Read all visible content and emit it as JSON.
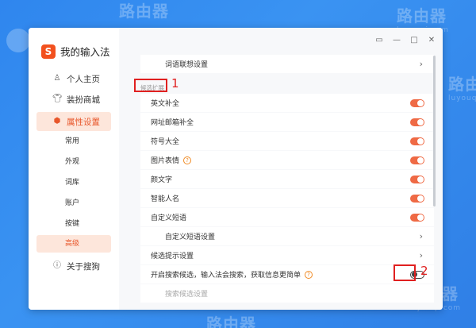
{
  "watermark": {
    "text": "路由器",
    "sub": "luyouqi.com"
  },
  "app": {
    "logo_char": "S",
    "title": "我的输入法"
  },
  "title_buttons": {
    "menu": "▭",
    "minimize": "—",
    "maximize": "□",
    "close": "✕"
  },
  "sidebar": {
    "items": [
      {
        "label": "个人主页",
        "icon": "person-icon"
      },
      {
        "label": "装扮商城",
        "icon": "shirt-icon"
      },
      {
        "label": "属性设置",
        "icon": "settings-icon",
        "active": true
      },
      {
        "label": "关于搜狗",
        "icon": "info-icon"
      }
    ],
    "sub_items": [
      "常用",
      "外观",
      "词库",
      "账户",
      "按键",
      "高级"
    ]
  },
  "content": {
    "top_row": "词语联想设置",
    "section_label": "候选扩展",
    "rows": [
      {
        "label": "英文补全",
        "toggle": "on"
      },
      {
        "label": "网址邮箱补全",
        "toggle": "on"
      },
      {
        "label": "符号大全",
        "toggle": "on"
      },
      {
        "label": "图片表情",
        "toggle": "on",
        "help": "?"
      },
      {
        "label": "颜文字",
        "toggle": "on"
      },
      {
        "label": "智能人名",
        "toggle": "on"
      },
      {
        "label": "自定义短语",
        "toggle": "on"
      },
      {
        "label": "自定义短语设置",
        "chevron": "›"
      },
      {
        "label": "候选提示设置",
        "chevron": "›"
      },
      {
        "label": "开启搜索候选，输入法会搜索，获取信息更简单",
        "toggle": "off",
        "help": "?"
      },
      {
        "label": "搜索候选设置"
      }
    ],
    "chevron": "›"
  },
  "annotations": {
    "one": "1",
    "two": "2"
  }
}
